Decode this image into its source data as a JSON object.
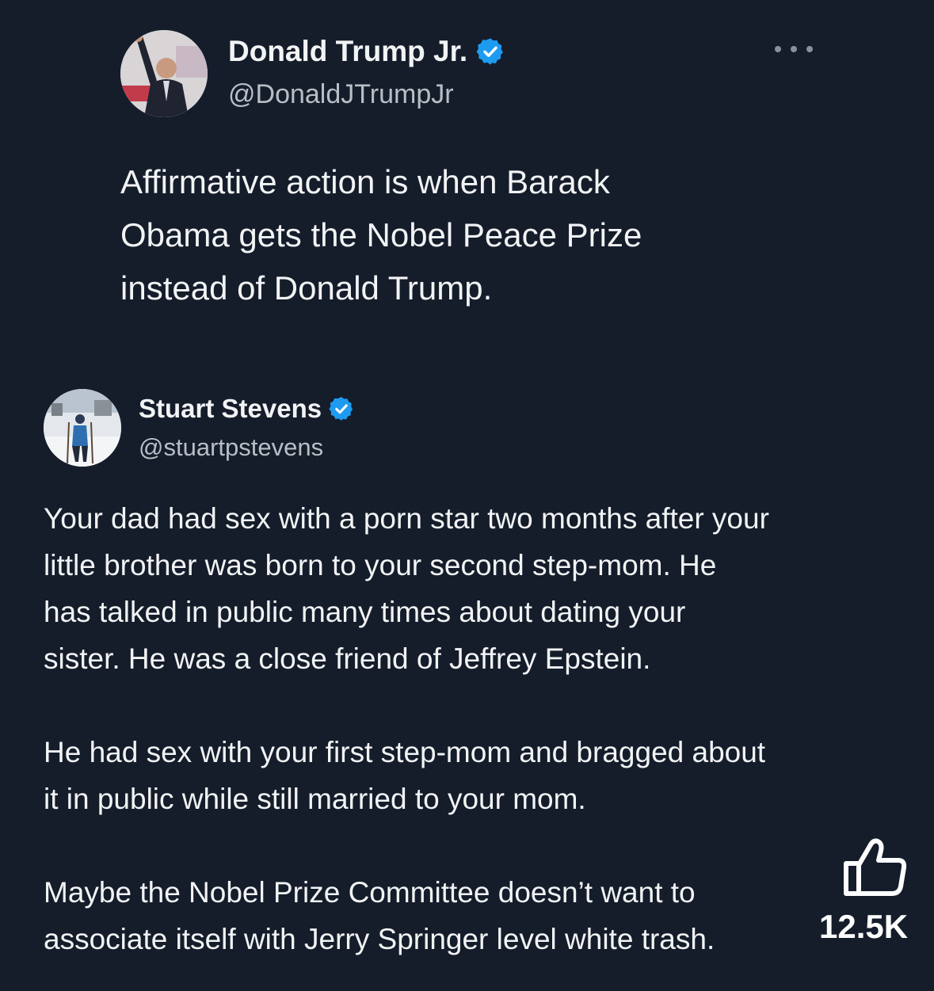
{
  "post": {
    "author_name": "Donald Trump Jr.",
    "author_handle": "@DonaldJTrumpJr",
    "text": "Affirmative action is when Barack\nObama gets the Nobel Peace Prize\ninstead of Donald Trump."
  },
  "reply": {
    "author_name": "Stuart Stevens",
    "author_handle": "@stuartpstevens",
    "paragraphs": [
      "Your dad had sex with a porn star two months after your\nlittle brother was born to your second step-mom. He\nhas talked in public many times about dating your\nsister. He was a close friend of Jeffrey Epstein.",
      "He had sex with your first step-mom and bragged about\nit in public while still married to your mom.",
      "Maybe the Nobel Prize Committee doesn’t want to\nassociate itself with Jerry Springer level white trash."
    ]
  },
  "overlay": {
    "like_count": "12.5K"
  },
  "icons": {
    "verified": "verified-badge-icon",
    "more": "more-options-icon",
    "like": "thumbs-up-icon"
  },
  "colors": {
    "background": "#151d2b",
    "verified_blue": "#1d9bf0",
    "text_primary": "#f2f3f4",
    "text_secondary": "#b9bec5"
  }
}
